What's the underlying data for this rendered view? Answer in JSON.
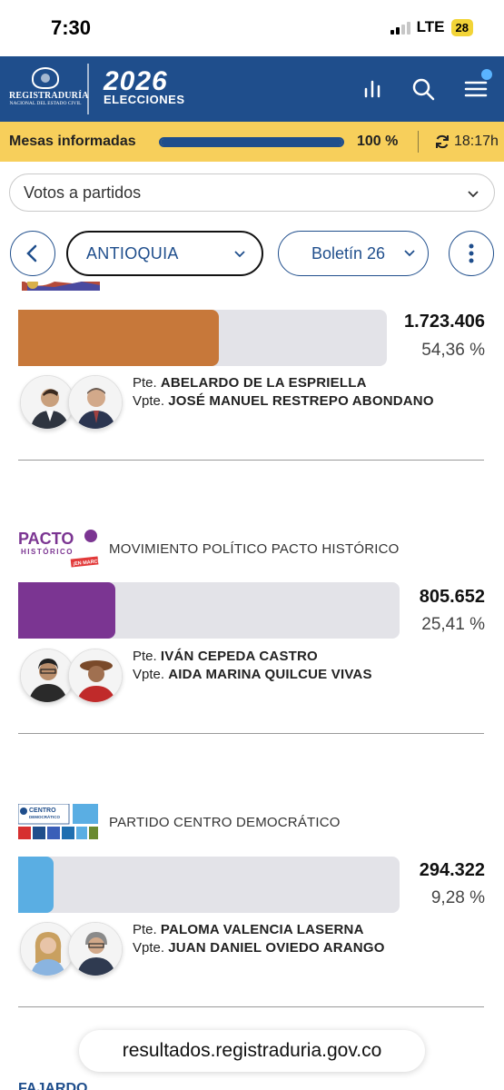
{
  "status_bar": {
    "time": "7:30",
    "network": "LTE",
    "battery": "28"
  },
  "header": {
    "brand_line1": "REGISTRADURÍA",
    "brand_line2": "NACIONAL DEL ESTADO CIVIL",
    "election_year": "2026",
    "election_label": "ELECCIONES",
    "icons": [
      "bar-chart-icon",
      "search-icon",
      "menu-icon"
    ]
  },
  "progress": {
    "label": "Mesas informadas",
    "fraction": 1.0,
    "percent_text": "100 %",
    "updated_time": "18:17h"
  },
  "filters": {
    "view_select": "Votos a partidos",
    "department": "ANTIOQUIA",
    "bulletin": "Boletín 26"
  },
  "results": [
    {
      "party_name": "",
      "votes": "1.723.406",
      "percent": "54,36 %",
      "share": 0.5436,
      "bar_color": "#c7783a",
      "president_prefix": "Pte.",
      "president": "ABELARDO DE LA ESPRIELLA",
      "vice_prefix": "Vpte.",
      "vice": "JOSÉ MANUEL RESTREPO ABONDANO"
    },
    {
      "party_name": "MOVIMIENTO POLÍTICO PACTO HISTÓRICO",
      "logo_text": "PACTO",
      "logo_sub": "HISTÓRICO",
      "logo_tag": "¡EN MARCHA!",
      "votes": "805.652",
      "percent": "25,41 %",
      "share": 0.2541,
      "bar_color": "#7b3592",
      "president_prefix": "Pte.",
      "president": "IVÁN CEPEDA CASTRO",
      "vice_prefix": "Vpte.",
      "vice": "AIDA MARINA QUILCUE VIVAS"
    },
    {
      "party_name": "PARTIDO CENTRO DEMOCRÁTICO",
      "logo_text": "CENTRO",
      "logo_sub": "DEMOCRÁTICO",
      "votes": "294.322",
      "percent": "9,28 %",
      "share": 0.0928,
      "bar_color": "#5aaee3",
      "president_prefix": "Pte.",
      "president": "PALOMA VALENCIA LASERNA",
      "vice_prefix": "Vpte.",
      "vice": "JUAN DANIEL OVIEDO ARANGO"
    }
  ],
  "next_party_logo_text": "FAJARDO",
  "url": "resultados.registraduria.gov.co"
}
